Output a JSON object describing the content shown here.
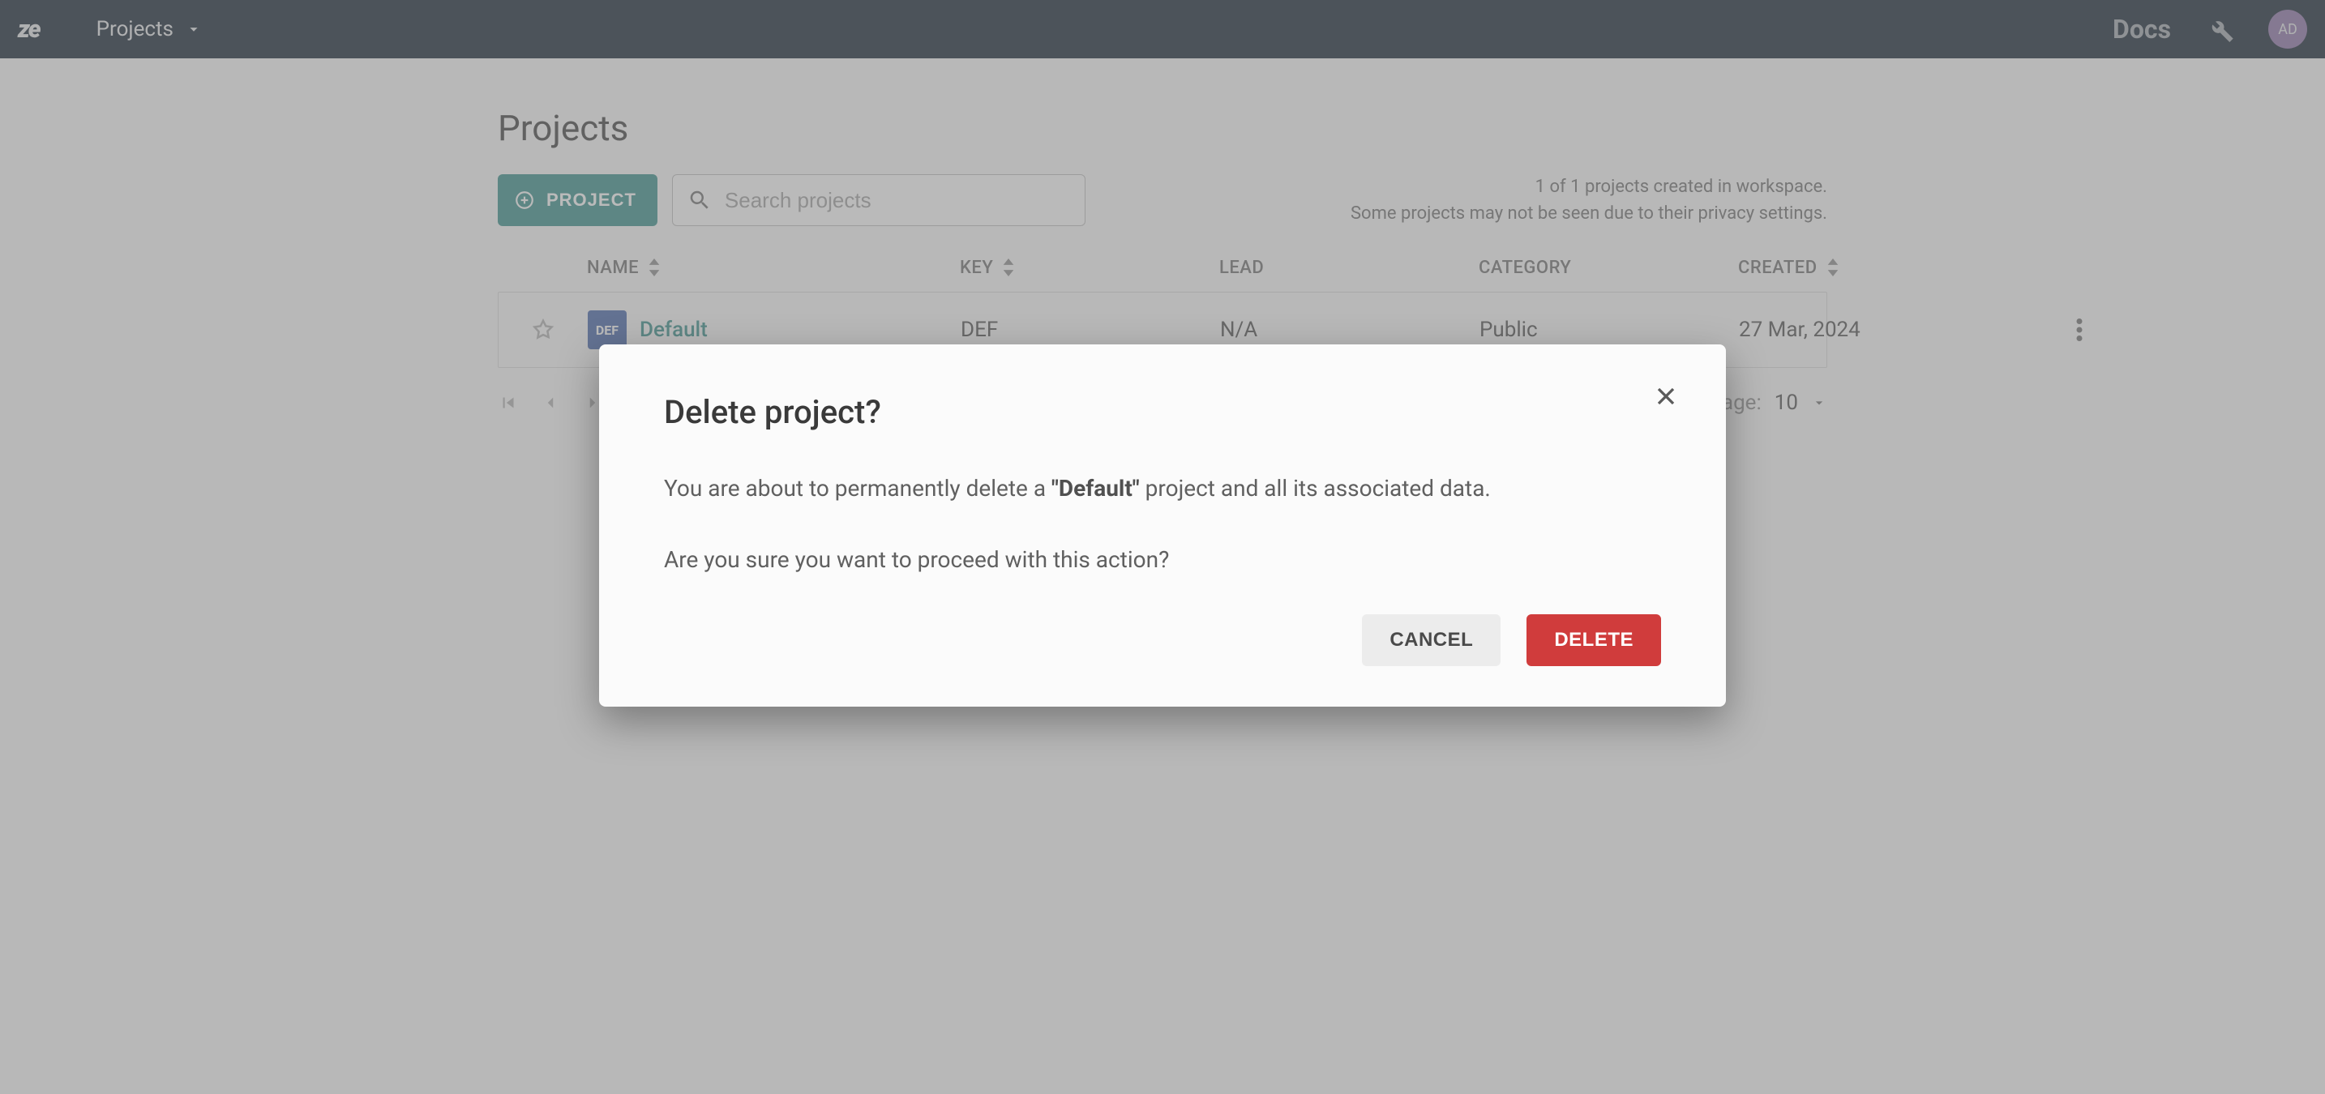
{
  "nav": {
    "logo": "ze",
    "projects_label": "Projects",
    "docs_label": "Docs",
    "avatar_initials": "AD"
  },
  "page": {
    "title": "Projects",
    "new_project_button": "PROJECT",
    "search_placeholder": "Search projects",
    "summary_line1": "1 of 1 projects created in workspace.",
    "summary_line2": "Some projects may not be seen due to their privacy settings."
  },
  "table": {
    "columns": {
      "name": "NAME",
      "key": "KEY",
      "lead": "LEAD",
      "category": "CATEGORY",
      "created": "CREATED"
    },
    "rows": [
      {
        "chip": "DEF",
        "name": "Default",
        "key": "DEF",
        "lead": "N/A",
        "category": "Public",
        "created": "27 Mar, 2024"
      }
    ]
  },
  "pagination": {
    "items_per_page_label": "Items per page:",
    "items_per_page_value": "10"
  },
  "modal": {
    "title": "Delete project?",
    "body_prefix": "You are about to permanently delete a ",
    "body_project_quoted": "\"Default\"",
    "body_suffix": " project and all its associated data.",
    "confirm_question": "Are you sure you want to proceed with this action?",
    "cancel_label": "CANCEL",
    "delete_label": "DELETE"
  }
}
